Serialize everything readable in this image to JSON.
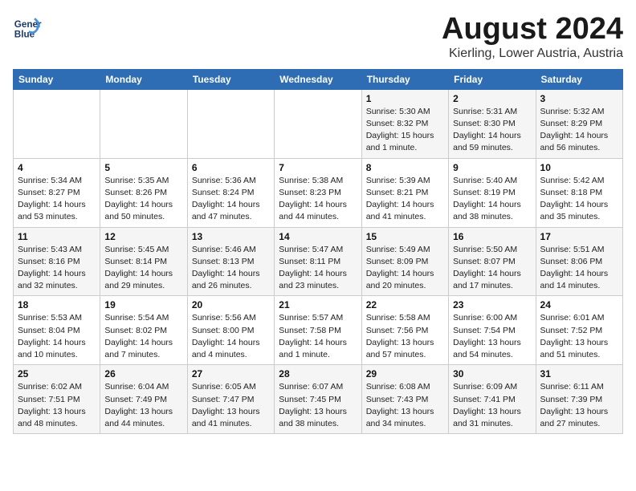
{
  "logo": {
    "line1": "General",
    "line2": "Blue"
  },
  "title": "August 2024",
  "location": "Kierling, Lower Austria, Austria",
  "days_of_week": [
    "Sunday",
    "Monday",
    "Tuesday",
    "Wednesday",
    "Thursday",
    "Friday",
    "Saturday"
  ],
  "weeks": [
    [
      {
        "day": "",
        "info": ""
      },
      {
        "day": "",
        "info": ""
      },
      {
        "day": "",
        "info": ""
      },
      {
        "day": "",
        "info": ""
      },
      {
        "day": "1",
        "info": "Sunrise: 5:30 AM\nSunset: 8:32 PM\nDaylight: 15 hours\nand 1 minute."
      },
      {
        "day": "2",
        "info": "Sunrise: 5:31 AM\nSunset: 8:30 PM\nDaylight: 14 hours\nand 59 minutes."
      },
      {
        "day": "3",
        "info": "Sunrise: 5:32 AM\nSunset: 8:29 PM\nDaylight: 14 hours\nand 56 minutes."
      }
    ],
    [
      {
        "day": "4",
        "info": "Sunrise: 5:34 AM\nSunset: 8:27 PM\nDaylight: 14 hours\nand 53 minutes."
      },
      {
        "day": "5",
        "info": "Sunrise: 5:35 AM\nSunset: 8:26 PM\nDaylight: 14 hours\nand 50 minutes."
      },
      {
        "day": "6",
        "info": "Sunrise: 5:36 AM\nSunset: 8:24 PM\nDaylight: 14 hours\nand 47 minutes."
      },
      {
        "day": "7",
        "info": "Sunrise: 5:38 AM\nSunset: 8:23 PM\nDaylight: 14 hours\nand 44 minutes."
      },
      {
        "day": "8",
        "info": "Sunrise: 5:39 AM\nSunset: 8:21 PM\nDaylight: 14 hours\nand 41 minutes."
      },
      {
        "day": "9",
        "info": "Sunrise: 5:40 AM\nSunset: 8:19 PM\nDaylight: 14 hours\nand 38 minutes."
      },
      {
        "day": "10",
        "info": "Sunrise: 5:42 AM\nSunset: 8:18 PM\nDaylight: 14 hours\nand 35 minutes."
      }
    ],
    [
      {
        "day": "11",
        "info": "Sunrise: 5:43 AM\nSunset: 8:16 PM\nDaylight: 14 hours\nand 32 minutes."
      },
      {
        "day": "12",
        "info": "Sunrise: 5:45 AM\nSunset: 8:14 PM\nDaylight: 14 hours\nand 29 minutes."
      },
      {
        "day": "13",
        "info": "Sunrise: 5:46 AM\nSunset: 8:13 PM\nDaylight: 14 hours\nand 26 minutes."
      },
      {
        "day": "14",
        "info": "Sunrise: 5:47 AM\nSunset: 8:11 PM\nDaylight: 14 hours\nand 23 minutes."
      },
      {
        "day": "15",
        "info": "Sunrise: 5:49 AM\nSunset: 8:09 PM\nDaylight: 14 hours\nand 20 minutes."
      },
      {
        "day": "16",
        "info": "Sunrise: 5:50 AM\nSunset: 8:07 PM\nDaylight: 14 hours\nand 17 minutes."
      },
      {
        "day": "17",
        "info": "Sunrise: 5:51 AM\nSunset: 8:06 PM\nDaylight: 14 hours\nand 14 minutes."
      }
    ],
    [
      {
        "day": "18",
        "info": "Sunrise: 5:53 AM\nSunset: 8:04 PM\nDaylight: 14 hours\nand 10 minutes."
      },
      {
        "day": "19",
        "info": "Sunrise: 5:54 AM\nSunset: 8:02 PM\nDaylight: 14 hours\nand 7 minutes."
      },
      {
        "day": "20",
        "info": "Sunrise: 5:56 AM\nSunset: 8:00 PM\nDaylight: 14 hours\nand 4 minutes."
      },
      {
        "day": "21",
        "info": "Sunrise: 5:57 AM\nSunset: 7:58 PM\nDaylight: 14 hours\nand 1 minute."
      },
      {
        "day": "22",
        "info": "Sunrise: 5:58 AM\nSunset: 7:56 PM\nDaylight: 13 hours\nand 57 minutes."
      },
      {
        "day": "23",
        "info": "Sunrise: 6:00 AM\nSunset: 7:54 PM\nDaylight: 13 hours\nand 54 minutes."
      },
      {
        "day": "24",
        "info": "Sunrise: 6:01 AM\nSunset: 7:52 PM\nDaylight: 13 hours\nand 51 minutes."
      }
    ],
    [
      {
        "day": "25",
        "info": "Sunrise: 6:02 AM\nSunset: 7:51 PM\nDaylight: 13 hours\nand 48 minutes."
      },
      {
        "day": "26",
        "info": "Sunrise: 6:04 AM\nSunset: 7:49 PM\nDaylight: 13 hours\nand 44 minutes."
      },
      {
        "day": "27",
        "info": "Sunrise: 6:05 AM\nSunset: 7:47 PM\nDaylight: 13 hours\nand 41 minutes."
      },
      {
        "day": "28",
        "info": "Sunrise: 6:07 AM\nSunset: 7:45 PM\nDaylight: 13 hours\nand 38 minutes."
      },
      {
        "day": "29",
        "info": "Sunrise: 6:08 AM\nSunset: 7:43 PM\nDaylight: 13 hours\nand 34 minutes."
      },
      {
        "day": "30",
        "info": "Sunrise: 6:09 AM\nSunset: 7:41 PM\nDaylight: 13 hours\nand 31 minutes."
      },
      {
        "day": "31",
        "info": "Sunrise: 6:11 AM\nSunset: 7:39 PM\nDaylight: 13 hours\nand 27 minutes."
      }
    ]
  ]
}
